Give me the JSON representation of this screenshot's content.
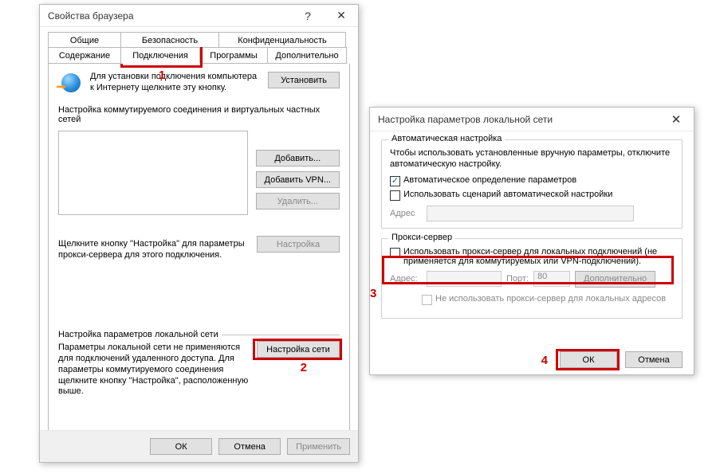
{
  "dialog1": {
    "title": "Свойства браузера",
    "help_btn": "?",
    "close_btn": "✕",
    "tabs": {
      "general": "Общие",
      "security": "Безопасность",
      "privacy": "Конфиденциальность",
      "content": "Содержание",
      "connections": "Подключения",
      "programs": "Программы",
      "advanced": "Дополнительно"
    },
    "install": {
      "text": "Для установки подключения компьютера к Интернету щелкните эту кнопку.",
      "button": "Установить"
    },
    "dialup": {
      "heading": "Настройка коммутируемого соединения и виртуальных частных сетей",
      "add": "Добавить...",
      "add_vpn": "Добавить VPN...",
      "remove": "Удалить...",
      "settings": "Настройка",
      "hint": "Щелкните кнопку \"Настройка\" для параметры прокси-сервера для этого подключения."
    },
    "lan": {
      "heading": "Настройка параметров локальной сети",
      "text": "Параметры локальной сети не применяются для подключений удаленного доступа. Для параметры коммутируемого соединения щелкните кнопку \"Настройка\", расположенную выше.",
      "button": "Настройка сети"
    },
    "footer": {
      "ok": "ОК",
      "cancel": "Отмена",
      "apply": "Применить"
    },
    "annotations": {
      "n1": "1",
      "n2": "2"
    }
  },
  "dialog2": {
    "title": "Настройка параметров локальной сети",
    "close_btn": "✕",
    "auto": {
      "heading": "Автоматическая настройка",
      "desc": "Чтобы использовать установленные вручную параметры, отключите автоматическую настройку.",
      "auto_detect": "Автоматическое определение параметров",
      "use_script": "Использовать сценарий автоматической настройки",
      "address_label": "Адрес"
    },
    "proxy": {
      "heading": "Прокси-сервер",
      "use_proxy": "Использовать прокси-сервер для локальных подключений (не применяется для коммутируемых или VPN-подключений).",
      "address_label": "Адрес:",
      "port_label": "Порт:",
      "port_value": "80",
      "advanced": "Дополнительно",
      "bypass_local": "Не использовать прокси-сервер для локальных адресов"
    },
    "footer": {
      "ok": "ОК",
      "cancel": "Отмена"
    },
    "annotations": {
      "n3": "3",
      "n4": "4"
    }
  }
}
